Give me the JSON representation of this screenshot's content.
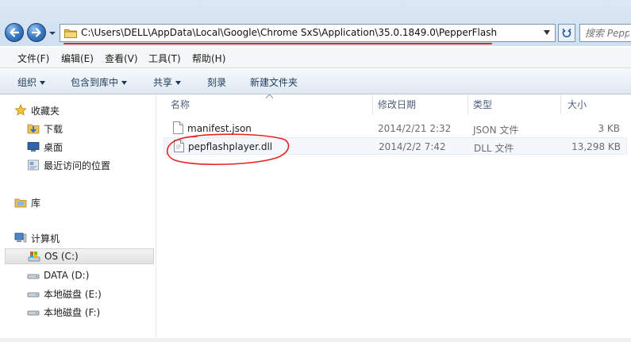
{
  "address_bar": {
    "path": "C:\\Users\\DELL\\AppData\\Local\\Google\\Chrome SxS\\Application\\35.0.1849.0\\PepperFlash",
    "search_placeholder": "搜索 PepperFlash"
  },
  "menu": {
    "items": [
      "文件(F)",
      "编辑(E)",
      "查看(V)",
      "工具(T)",
      "帮助(H)"
    ]
  },
  "toolbar": {
    "organize": "组织",
    "include_in_library": "包含到库中",
    "share": "共享",
    "burn": "刻录",
    "new_folder": "新建文件夹"
  },
  "nav": {
    "favorites": "收藏夹",
    "downloads": "下载",
    "desktop": "桌面",
    "recent": "最近访问的位置",
    "libraries": "库",
    "computer": "计算机",
    "drives": [
      {
        "label": "OS (C:)",
        "selected": true
      },
      {
        "label": "DATA (D:)",
        "selected": false
      },
      {
        "label": "本地磁盘 (E:)",
        "selected": false
      },
      {
        "label": "本地磁盘 (F:)",
        "selected": false
      }
    ]
  },
  "columns": {
    "name": "名称",
    "modified": "修改日期",
    "type": "类型",
    "size": "大小"
  },
  "files": [
    {
      "name": "manifest.json",
      "modified": "2014/2/21 2:32",
      "type": "JSON 文件",
      "size": "3 KB"
    },
    {
      "name": "pepflashplayer.dll",
      "modified": "2014/2/2 7:42",
      "type": "DLL 文件",
      "size": "13,298 KB"
    }
  ],
  "colors": {
    "annotation_red": "#e82020",
    "toolbar_text": "#1e395b",
    "header_text": "#4c607a"
  }
}
